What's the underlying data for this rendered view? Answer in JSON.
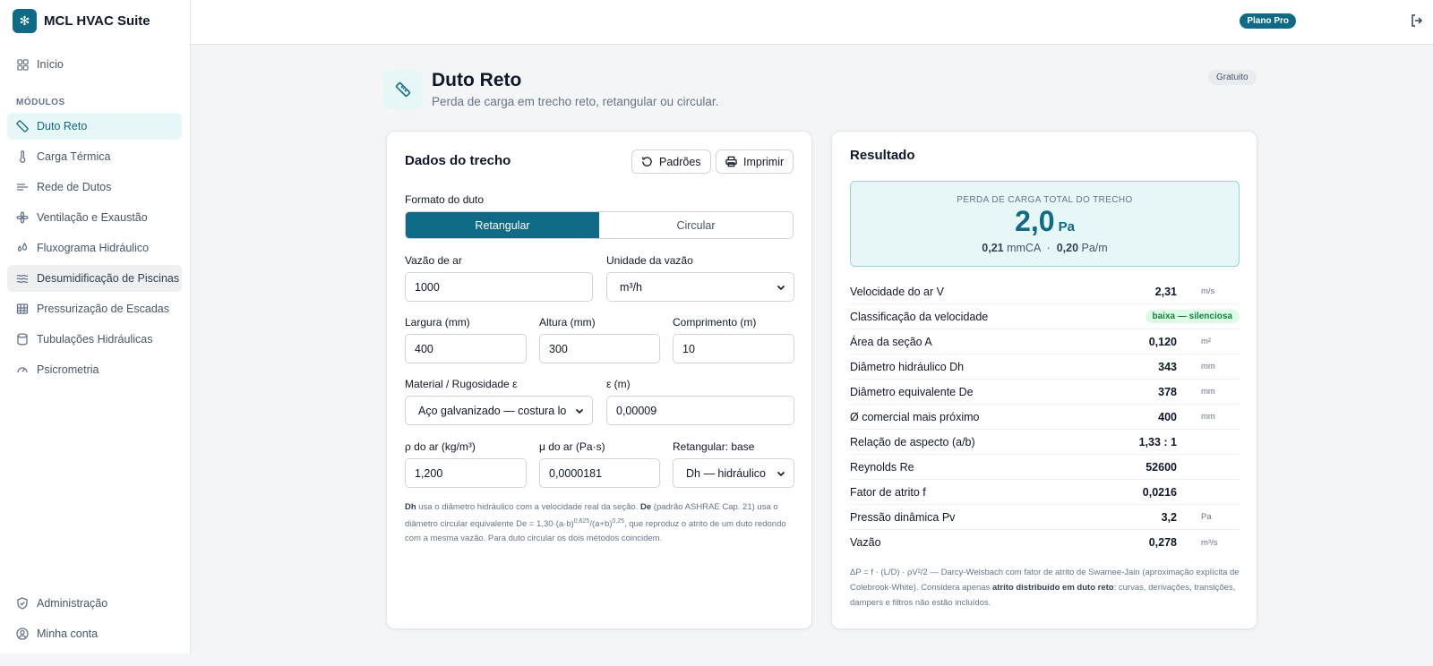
{
  "app": {
    "name": "MCL HVAC Suite"
  },
  "sidebar": {
    "home": "Início",
    "section": "MÓDULOS",
    "items": [
      {
        "label": "Duto Reto",
        "icon": "ruler-icon"
      },
      {
        "label": "Carga Térmica",
        "icon": "thermometer-icon"
      },
      {
        "label": "Rede de Dutos",
        "icon": "duct-network-icon"
      },
      {
        "label": "Ventilação e Exaustão",
        "icon": "fan-icon"
      },
      {
        "label": "Fluxograma Hidráulico",
        "icon": "droplets-icon"
      },
      {
        "label": "Desumidificação de Piscinas",
        "icon": "waves-icon"
      },
      {
        "label": "Pressurização de Escadas",
        "icon": "building-icon"
      },
      {
        "label": "Tubulações Hidráulicas",
        "icon": "cylinder-icon"
      },
      {
        "label": "Psicrometria",
        "icon": "gauge-icon"
      }
    ],
    "admin": "Administração",
    "account": "Minha conta"
  },
  "topbar": {
    "plan": "Plano Pro"
  },
  "page": {
    "title": "Duto Reto",
    "subtitle": "Perda de carga em trecho reto, retangular ou circular.",
    "badge": "Gratuito"
  },
  "form": {
    "title": "Dados do trecho",
    "defaults_btn": "Padrões",
    "print_btn": "Imprimir",
    "shape_label": "Formato do duto",
    "shape_options": [
      "Retangular",
      "Circular"
    ],
    "flow_label": "Vazão de ar",
    "flow_value": "1000",
    "flow_unit_label": "Unidade da vazão",
    "flow_unit_value": "m³/h",
    "width_label": "Largura (mm)",
    "width_value": "400",
    "height_label": "Altura (mm)",
    "height_value": "300",
    "length_label": "Comprimento (m)",
    "length_value": "10",
    "material_label": "Material / Rugosidade ε",
    "material_value": "Aço galvanizado — costura longitudinal",
    "eps_label": "ε (m)",
    "eps_value": "0,00009",
    "rho_label": "ρ do ar (kg/m³)",
    "rho_value": "1,200",
    "mu_label": "μ do ar (Pa·s)",
    "mu_value": "0,0000181",
    "base_label": "Retangular: base",
    "base_value": "Dh — hidráulico",
    "note": {
      "b1": "Dh",
      "t1": " usa o diâmetro hidráulico com a velocidade real da seção. ",
      "b2": "De",
      "t2": " (padrão ASHRAE Cap. 21) usa o diâmetro circular equivalente De = 1,30·(a·b)",
      "s1": "0,625",
      "t3": "/(a+b)",
      "s2": "0,25",
      "t4": ", que reproduz o atrito de um duto redondo com a mesma vazão. Para duto circular os dois métodos coincidem."
    }
  },
  "result": {
    "title": "Resultado",
    "total_label": "PERDA DE CARGA TOTAL DO TRECHO",
    "total_value": "2,0",
    "total_unit": "Pa",
    "sub1_value": "0,21",
    "sub1_unit": "mmCA",
    "sep": "·",
    "sub2_value": "0,20",
    "sub2_unit": "Pa/m",
    "rows": [
      {
        "label": "Velocidade do ar V",
        "value": "2,31",
        "unit": "m/s"
      },
      {
        "label": "Classificação da velocidade",
        "tag": "baixa — silenciosa"
      },
      {
        "label": "Área da seção A",
        "value": "0,120",
        "unit": "m²"
      },
      {
        "label": "Diâmetro hidráulico Dh",
        "value": "343",
        "unit": "mm"
      },
      {
        "label": "Diâmetro equivalente De",
        "value": "378",
        "unit": "mm"
      },
      {
        "label": "Ø comercial mais próximo",
        "value": "400",
        "unit": "mm"
      },
      {
        "label": "Relação de aspecto (a/b)",
        "value": "1,33 : 1",
        "unit": ""
      },
      {
        "label": "Reynolds Re",
        "value": "52600",
        "unit": ""
      },
      {
        "label": "Fator de atrito f",
        "value": "0,0216",
        "unit": ""
      },
      {
        "label": "Pressão dinâmica Pv",
        "value": "3,2",
        "unit": "Pa"
      },
      {
        "label": "Vazão",
        "value": "0,278",
        "unit": "m³/s"
      }
    ],
    "formula": {
      "t1": "ΔP = f · (L/D) · ρV²/2 — Darcy-Weisbach com fator de atrito de Swamee-Jain (aproximação explícita de Colebrook-White). Considera apenas ",
      "b1": "atrito distribuído em duto reto",
      "t2": ": curvas, derivações, transições, dampers e filtros não estão incluídos."
    }
  },
  "colors": {
    "accent": "#0e6a85",
    "accent_light": "#e7f7f8",
    "success": "#15803d"
  }
}
